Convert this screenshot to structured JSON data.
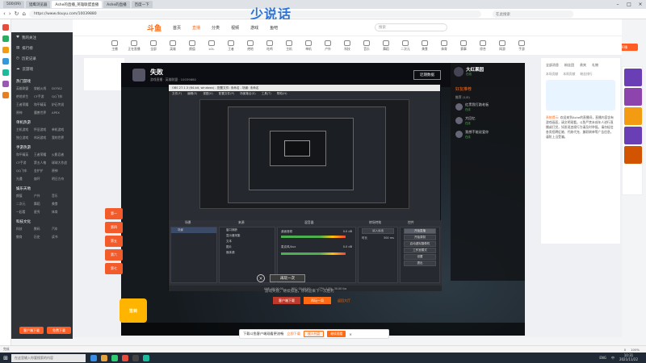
{
  "browser": {
    "tabs": [
      "500(09)",
      "猎鹰浏览器",
      "Ashe的直播_英雄联盟直播",
      "Ashe的直播",
      "百度一下"
    ],
    "url": "https://www.douyu.com/10039880",
    "search_placeholder": "在此搜索",
    "watermark": "少说话"
  },
  "site": {
    "logo": "斗鱼",
    "nav": [
      "首页",
      "直播",
      "分类",
      "视频",
      "游戏",
      "鱼吧"
    ],
    "search_placeholder": "搜索",
    "promo_button": "开播"
  },
  "categories": [
    "主播",
    "正在直播",
    "全部",
    "英雄",
    "颜值",
    "LOL",
    "王者",
    "绝地",
    "吃鸡",
    "主机",
    "单机",
    "户外",
    "科技",
    "音乐",
    "舞蹈",
    "二次元",
    "美食",
    "体育",
    "赛事",
    "综合",
    "网游",
    "手游"
  ],
  "left_sidebar": {
    "items": [
      "我的关注",
      "排行榜",
      "历史记录",
      "云游戏"
    ],
    "sections": [
      {
        "title": "热门游戏",
        "grid": [
          "英雄联盟",
          "穿越火线",
          "DOTA2",
          "绝地求生",
          "CF手游",
          "QQ飞车",
          "王者荣耀",
          "和平精英",
          "炉石传说",
          "原神",
          "魔兽世界",
          "APEX"
        ]
      },
      {
        "title": "单机热游",
        "grid": [
          "主机游戏",
          "怀旧游戏",
          "单机游戏",
          "独立游戏",
          "休闲游戏",
          "我的世界"
        ]
      },
      {
        "title": "手游热游",
        "grid": [
          "和平精英",
          "王者荣耀",
          "火影忍者",
          "CF手游",
          "第五人格",
          "球球大作战",
          "QQ飞车",
          "金铲铲",
          "原神",
          "光遇",
          "崩坏",
          "明日方舟"
        ]
      },
      {
        "title": "娱乐天地",
        "grid": [
          "颜值",
          "户外",
          "音乐",
          "二次元",
          "舞蹈",
          "美食",
          "一起看",
          "星秀",
          "体育"
        ]
      },
      {
        "title": "科技文化",
        "grid": [
          "科技",
          "数码",
          "汽车",
          "教育",
          "历史",
          "读书"
        ]
      }
    ],
    "buttons": [
      "客户端下载",
      "免费下载"
    ]
  },
  "stream": {
    "title": "失败",
    "subtitle": "游戏直播 · 英雄联盟 · 10039880",
    "data_button": "近期数据",
    "obs": {
      "title": "OBS 27.1.3 (64-bit, windows) - 配置文件: 未命名 - 场景: 未命名",
      "menu": [
        "文件(F)",
        "编辑(E)",
        "视图(V)",
        "配置文件(P)",
        "场景集合(S)",
        "工具(T)",
        "帮助(H)"
      ],
      "docks": [
        "场景",
        "来源",
        "混音器",
        "转场特效",
        "控件"
      ],
      "scenes": [
        "场景"
      ],
      "sources": [
        "窗口捕获",
        "显示器采集",
        "文本",
        "图片",
        "媒体源"
      ],
      "mixer": [
        {
          "name": "桌面音频",
          "level": "0.0 dB"
        },
        {
          "name": "麦克风/Aux",
          "level": "0.0 dB"
        }
      ],
      "transition": {
        "name": "淡入淡出",
        "duration_label": "时长",
        "duration": "300 ms"
      },
      "controls": [
        "开始直播",
        "开始录制",
        "启动虚拟摄像机",
        "工作室模式",
        "设置",
        "退出"
      ],
      "status": [
        "LIVE: 00:00:00",
        "REC: 00:00:00",
        "CPU: 1.8%, 30.00 fps"
      ]
    },
    "replay_button": "再玩一次",
    "close_glyph": "×",
    "game_text": "游戏失败，继续加油，你将迎来下一次胜利",
    "game_buttons": [
      "客户端下载",
      "再玩一局",
      "返回大厅"
    ]
  },
  "chat": {
    "user_name": "大红果园",
    "user_status": "在线",
    "section_title": "好友推荐",
    "group": "推荐 (1/5)",
    "friends": [
      {
        "name": "红黑我打路老板",
        "status": "在线"
      },
      {
        "name": "大回忆",
        "status": "在线"
      },
      {
        "name": "我想不能说爱你",
        "status": "在线"
      }
    ]
  },
  "right_panel": {
    "tabs": [
      "全部消息",
      "粉丝团",
      "贵宾",
      "礼物"
    ],
    "subtabs": [
      "本场贡献",
      "本周贡献",
      "粉丝排行"
    ],
    "notice_label": "系统提示:",
    "notice": "欢迎来到Ashe的直播间，直播内容含有游戏画面，请文明观看。斗鱼严禁未成年人进行直播或打赏，如发现违规行为请及时举报。请勿轻信各类招聘征婚、代练代充、兼职刷单等广告信息，谨防上当受骗。"
  },
  "floating": {
    "badges": [
      "第一",
      "第四",
      "第五",
      "第六",
      "第七"
    ],
    "signin": "签到"
  },
  "download_bar": {
    "text": "下载斗鱼客户端观看更流畅",
    "link": "立即下载",
    "btn1": "放入托盘",
    "btn2": "继续观看"
  },
  "bottom_status": [
    "完成",
    "0",
    "100%"
  ],
  "taskbar": {
    "search_placeholder": "在这里输入你要搜索的内容",
    "tray": [
      "ENG",
      "中"
    ],
    "time": "10:31",
    "date": "2021/11/22"
  },
  "colors": {
    "accent": "#ff6a13",
    "dark": "#2f3338",
    "taskbar": "#1f2a36",
    "chrome": "#dfe3e8"
  }
}
